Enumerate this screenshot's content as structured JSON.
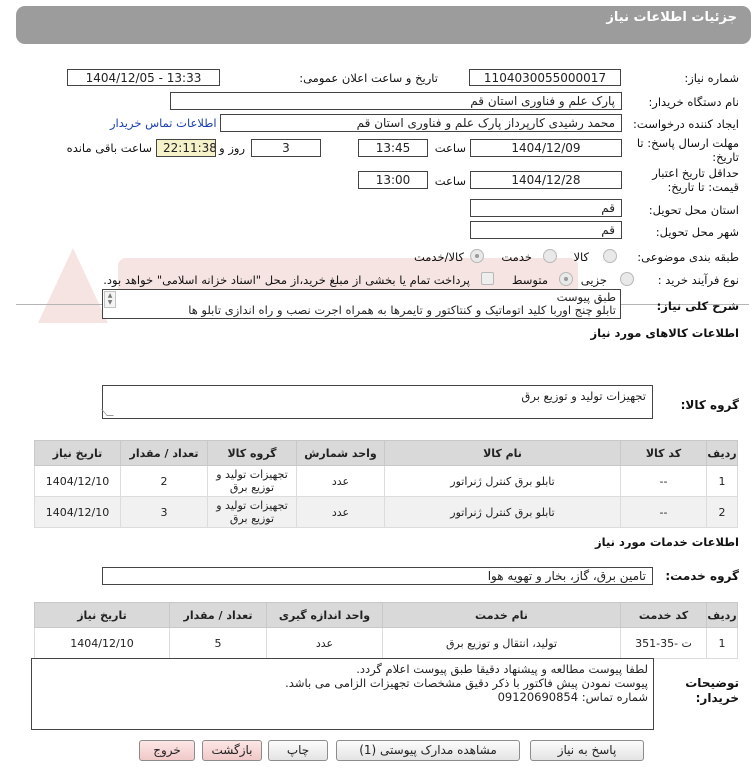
{
  "header": {
    "title": "جزئیات اطلاعات نیاز"
  },
  "fields": {
    "need_number_label": "شماره نیاز:",
    "need_number": "1104030055000017",
    "announce_label": "تاریخ و ساعت اعلان عمومی:",
    "announce_value": "1404/12/05 - 13:33",
    "buyer_org_label": "نام دستگاه خریدار:",
    "buyer_org": "پارک علم و فناوری استان قم",
    "creator_label": "ایجاد کننده درخواست:",
    "creator": "محمد رشیدی کارپرداز پارک علم و فناوری استان قم",
    "contact_link": "اطلاعات تماس خریدار",
    "deadline_label_1": "مهلت ارسال پاسخ: تا",
    "deadline_label_2": "تاریخ:",
    "deadline_date": "1404/12/09",
    "time_label": "ساعت",
    "deadline_time": "13:45",
    "days_count": "3",
    "days_label": "روز و",
    "remaining_time": "22:11:38",
    "remaining_label": "ساعت باقی مانده",
    "validity_label_1": "حداقل تاریخ اعتبار",
    "validity_label_2": "قیمت: تا تاریخ:",
    "validity_date": "1404/12/28",
    "validity_time": "13:00",
    "province_label": "استان محل تحویل:",
    "province": "قم",
    "city_label": "شهر محل تحویل:",
    "city": "قم",
    "category_label": "طبقه بندی موضوعی:",
    "category_options": [
      "کالا",
      "خدمت",
      "کالا/خدمت"
    ],
    "process_label": "نوع فرآیند خرید :",
    "process_options": [
      "جزیی",
      "متوسط"
    ],
    "payment_note": "پرداخت تمام یا بخشی از مبلغ خرید،از محل \"اسناد خزانه اسلامی\" خواهد بود."
  },
  "description": {
    "label": "شرح کلی نیاز:",
    "line1": "طبق پیوست",
    "line2": "تابلو چنج اوربا کلید اتوماتیک و کنتاکتور و تایمرها به همراه اجرت نصب و راه اندازی تابلو ها"
  },
  "goods": {
    "section_title": "اطلاعات کالاهای مورد نیاز",
    "group_label": "گروه کالا:",
    "group_value": "تجهیزات تولید و توزیع برق",
    "columns": [
      "ردیف",
      "کد کالا",
      "نام کالا",
      "واحد شمارش",
      "گروه کالا",
      "تعداد / مقدار",
      "تاریخ نیاز"
    ],
    "rows": [
      {
        "row": "1",
        "code": "--",
        "name": "تابلو برق کنترل ژنراتور",
        "unit": "عدد",
        "group_l1": "تجهیزات تولید و",
        "group_l2": "توزیع برق",
        "qty": "2",
        "date": "1404/12/10"
      },
      {
        "row": "2",
        "code": "--",
        "name": "تابلو برق کنترل ژنراتور",
        "unit": "عدد",
        "group_l1": "تجهیزات تولید و",
        "group_l2": "توزیع برق",
        "qty": "3",
        "date": "1404/12/10"
      }
    ]
  },
  "services": {
    "section_title": "اطلاعات خدمات مورد نیاز",
    "group_label": "گروه خدمت:",
    "group_value": "تامین برق، گاز، بخار و تهویه هوا",
    "columns": [
      "ردیف",
      "کد خدمت",
      "نام خدمت",
      "واحد اندازه گیری",
      "تعداد / مقدار",
      "تاریخ نیاز"
    ],
    "rows": [
      {
        "row": "1",
        "code": "ت -35-351",
        "name": "تولید، انتقال و توزیع برق",
        "unit": "عدد",
        "qty": "5",
        "date": "1404/12/10"
      }
    ]
  },
  "buyer_notes": {
    "label_1": "توضیحات",
    "label_2": "خریدار:",
    "line1": "لطفا پیوست مطالعه و پیشنهاد دقیقا طبق پیوست اعلام گردد.",
    "line2": "پیوست نمودن پیش فاکتور با ذکر دقیق مشخصات تجهیزات الزامی می باشد.",
    "line3": "شماره تماس: 09120690854"
  },
  "buttons": {
    "reply": "پاسخ به نیاز",
    "attachments": "مشاهده مدارک پیوستی (1)",
    "print": "چاپ",
    "back": "بازگشت",
    "exit": "خروج"
  },
  "colors": {
    "header_bg": "#9c9c9c",
    "highlight_time": "#f5f1c8",
    "link": "#1a3fb0",
    "table_header": "#d9d9d9"
  }
}
